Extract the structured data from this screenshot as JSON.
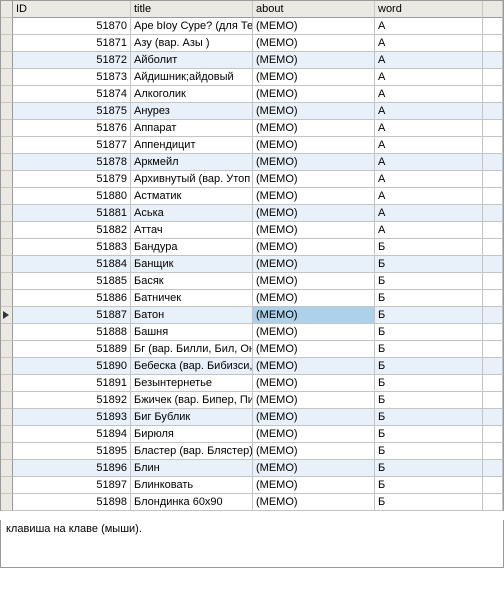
{
  "columns": {
    "id": "ID",
    "title": "title",
    "about": "about",
    "word": "word"
  },
  "rows": [
    {
      "id": "51870",
      "title": "Ape bIoy Cype? (для Те",
      "about": "(MEMO)",
      "word": "А"
    },
    {
      "id": "51871",
      "title": "Азу (вар. Азы )",
      "about": "(MEMO)",
      "word": "А"
    },
    {
      "id": "51872",
      "title": "Айболит",
      "about": "(MEMO)",
      "word": "А"
    },
    {
      "id": "51873",
      "title": "Айдишник;айдовый",
      "about": "(MEMO)",
      "word": "А"
    },
    {
      "id": "51874",
      "title": "Алкоголик",
      "about": "(MEMO)",
      "word": "А"
    },
    {
      "id": "51875",
      "title": "Анурез",
      "about": "(MEMO)",
      "word": "А"
    },
    {
      "id": "51876",
      "title": "Аппарат",
      "about": "(MEMO)",
      "word": "А"
    },
    {
      "id": "51877",
      "title": "Аппендицит",
      "about": "(MEMO)",
      "word": "А"
    },
    {
      "id": "51878",
      "title": "Аркмейл",
      "about": "(MEMO)",
      "word": "А"
    },
    {
      "id": "51879",
      "title": "Архивнутый (вар. Утоп",
      "about": "(MEMO)",
      "word": "А"
    },
    {
      "id": "51880",
      "title": "Астматик",
      "about": "(MEMO)",
      "word": "А"
    },
    {
      "id": "51881",
      "title": "Аська",
      "about": "(MEMO)",
      "word": "А"
    },
    {
      "id": "51882",
      "title": "Аттач",
      "about": "(MEMO)",
      "word": "А"
    },
    {
      "id": "51883",
      "title": "Бандура",
      "about": "(MEMO)",
      "word": "Б"
    },
    {
      "id": "51884",
      "title": "Банщик",
      "about": "(MEMO)",
      "word": "Б"
    },
    {
      "id": "51885",
      "title": "Басяк",
      "about": "(MEMO)",
      "word": "Б"
    },
    {
      "id": "51886",
      "title": "Батничек",
      "about": "(MEMO)",
      "word": "Б"
    },
    {
      "id": "51887",
      "title": "Батон",
      "about": "(MEMO)",
      "word": "Б"
    },
    {
      "id": "51888",
      "title": "Башня",
      "about": "(MEMO)",
      "word": "Б"
    },
    {
      "id": "51889",
      "title": "Бг (вар. Билли, Бил, Он",
      "about": "(MEMO)",
      "word": "Б"
    },
    {
      "id": "51890",
      "title": "Бебеска (вар. Бибизси,",
      "about": "(MEMO)",
      "word": "Б"
    },
    {
      "id": "51891",
      "title": "Безынтернетье",
      "about": "(MEMO)",
      "word": "Б"
    },
    {
      "id": "51892",
      "title": "Бжичек (вар. Бипер, Пи",
      "about": "(MEMO)",
      "word": "Б"
    },
    {
      "id": "51893",
      "title": "Биг Бублик",
      "about": "(MEMO)",
      "word": "Б"
    },
    {
      "id": "51894",
      "title": "Бирюля",
      "about": "(MEMO)",
      "word": "Б"
    },
    {
      "id": "51895",
      "title": "Бластер (вар. Блястер)",
      "about": "(MEMO)",
      "word": "Б"
    },
    {
      "id": "51896",
      "title": "Блин",
      "about": "(MEMO)",
      "word": "Б"
    },
    {
      "id": "51897",
      "title": "Блинковать",
      "about": "(MEMO)",
      "word": "Б"
    },
    {
      "id": "51898",
      "title": "Блондинка 60х90",
      "about": "(MEMO)",
      "word": "Б"
    }
  ],
  "selected_index": 17,
  "alt_indices": [
    2,
    5,
    8,
    11,
    14,
    17,
    20,
    23,
    26
  ],
  "memo_text": "клавиша на клаве (мыши)."
}
